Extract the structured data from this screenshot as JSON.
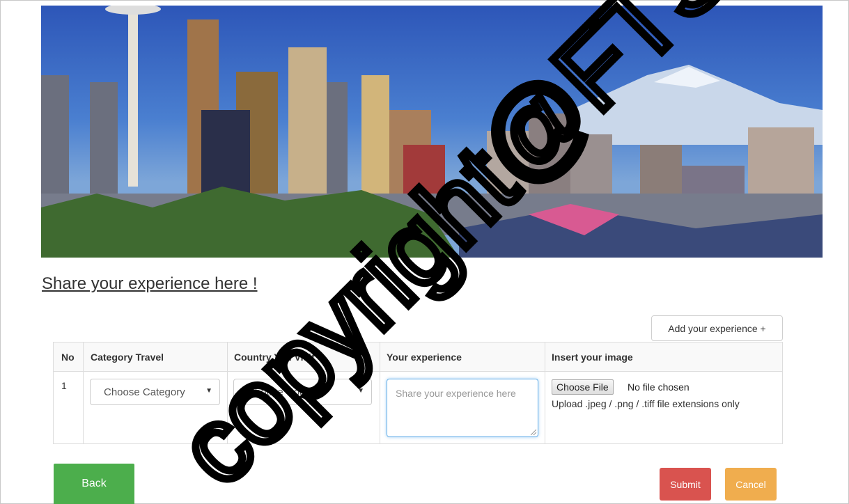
{
  "page": {
    "title": "Share your experience here !",
    "add_button_label": "Add your experience +"
  },
  "table": {
    "headers": [
      "No",
      "Category Travel",
      "Country You Visit",
      "Your experience",
      "Insert your image"
    ],
    "rows": [
      {
        "no": "1",
        "category_select": "Choose Category",
        "country_select": "Choose Country",
        "experience_placeholder": "Share your experience here",
        "file_button_label": "Choose File",
        "file_status": "No file chosen",
        "file_hint": "Upload .jpeg / .png / .tiff file extensions only"
      }
    ]
  },
  "actions": {
    "back_label": "Back",
    "submit_label": "Submit",
    "cancel_label": "Cancel"
  },
  "colors": {
    "back": "#4cae4c",
    "submit": "#d9534f",
    "cancel": "#f0ad4e",
    "focus_border": "#66afe9"
  },
  "watermark": {
    "text": "copyright@FTSM"
  },
  "icons": {
    "select_caret": "caret-down-icon",
    "resize_grip": "resize-grip-icon"
  }
}
